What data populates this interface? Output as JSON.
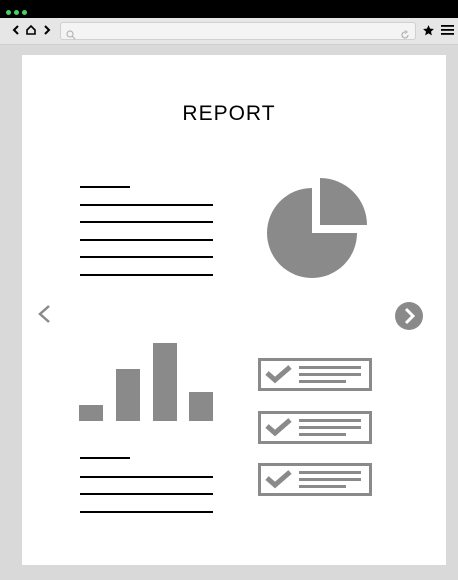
{
  "browser": {
    "window_dots": [
      "#49d16a",
      "#49d16a",
      "#49d16a"
    ],
    "nav_icons": [
      "chevron-left-icon",
      "home-icon",
      "chevron-right-icon"
    ],
    "url_value": "",
    "right_icons": [
      "reload-icon",
      "star-icon",
      "menu-icon"
    ]
  },
  "report": {
    "title": "REPORT",
    "text_block_top": {
      "line_count": 6
    },
    "pie_chart": {
      "slices": [
        75,
        25
      ],
      "colors": [
        "#8a8a8a",
        "#8a8a8a"
      ]
    },
    "bar_chart": {
      "values": [
        1.0,
        3.3,
        5.0,
        1.9
      ],
      "color": "#8a8a8a"
    },
    "text_block_bottom": {
      "line_count": 4
    },
    "checklist": [
      {
        "checked": true
      },
      {
        "checked": true
      },
      {
        "checked": true
      }
    ]
  },
  "carousel": {
    "prev": "<",
    "next_icon": "chevron-right-circle-icon",
    "accent": "#8a8a8a"
  }
}
